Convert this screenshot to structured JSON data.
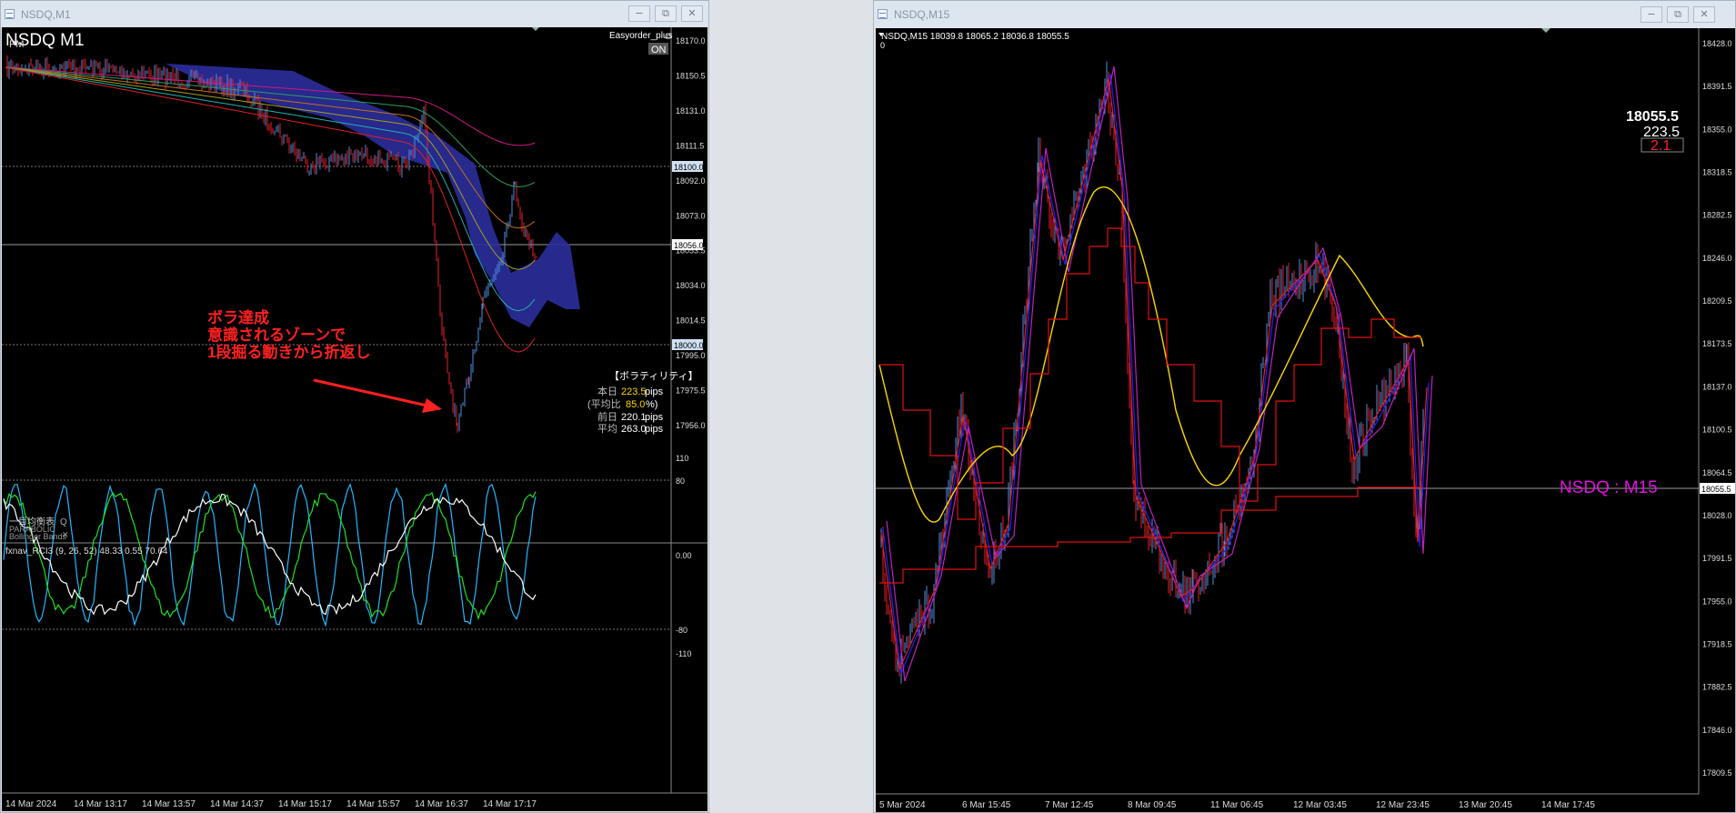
{
  "window_left": {
    "title": "NSDQ,M1",
    "symbol_label": "NSDQ M1",
    "pm_tag": "PM",
    "ea_name": "Easyorder_plus",
    "on_button": "ON",
    "annotation": [
      "ボラ達成",
      "意識されるゾーンで",
      "1段掘る動きから折返し"
    ],
    "vol_panel": {
      "heading": "【ボラティリティ】",
      "today_label": "本日",
      "today_value": "223.5",
      "ratio_label": "(平均比",
      "ratio_value": "85.0",
      "ratio_unit": "%)",
      "prev_label": "前日",
      "prev_value": "220.1",
      "avg_label": "平均",
      "avg_value": "263.0",
      "unit": "pips"
    },
    "indicator_labels": [
      "一目均衡表",
      "PARABOLIC",
      "Bollinger Bands"
    ],
    "price_axis": [
      "18170.0",
      "18150.5",
      "18131.0",
      "18111.5",
      "18092.0",
      "18073.0",
      "18053.5",
      "18034.0",
      "18014.5",
      "17995.0",
      "17975.5",
      "17956.0"
    ],
    "price_tags": [
      {
        "label": "18100.0",
        "kind": "level"
      },
      {
        "label": "18056.0",
        "kind": "current"
      },
      {
        "label": "18000.0",
        "kind": "level"
      }
    ],
    "rci_title": "fxnav_RCI3 (9, 26, 52) 48.33 0.55 70.64",
    "rci_axis": [
      "110",
      "80",
      "0.00",
      "-80",
      "-110"
    ],
    "time_axis": [
      "14 Mar 2024",
      "14 Mar 13:17",
      "14 Mar 13:57",
      "14 Mar 14:37",
      "14 Mar 15:17",
      "14 Mar 15:57",
      "14 Mar 16:37",
      "14 Mar 17:17"
    ]
  },
  "window_right": {
    "title": "NSDQ,M15",
    "ohlc_line": "NSDQ,M15  18039.8 18065.2 18036.8 18055.5",
    "sub_zero": "0",
    "price_big": "18055.5",
    "range_value": "223.5",
    "ratio_value": "2.1",
    "watermark": "NSDQ : M15",
    "price_axis": [
      "18428.0",
      "18391.5",
      "18355.0",
      "18318.5",
      "18282.5",
      "18246.0",
      "18209.5",
      "18173.5",
      "18137.0",
      "18100.5",
      "18064.5",
      "18028.0",
      "17991.5",
      "17955.0",
      "17918.5",
      "17882.5",
      "17846.0",
      "17809.5"
    ],
    "current_tag": "18055.5",
    "time_axis": [
      "5 Mar 2024",
      "6 Mar 15:45",
      "7 Mar 12:45",
      "8 Mar 09:45",
      "11 Mar 06:45",
      "12 Mar 03:45",
      "12 Mar 23:45",
      "13 Mar 20:45",
      "14 Mar 17:45"
    ]
  },
  "colors": {
    "bull": "#4f8fe0",
    "bear": "#e8202a",
    "cloud": "#2b2d9c",
    "annotation": "#ff2020",
    "magenta": "#e010e0",
    "gold": "#ffd700",
    "rci_fast": "#22b8ff",
    "rci_mid": "#22e022",
    "rci_slow": "#ffffff"
  }
}
